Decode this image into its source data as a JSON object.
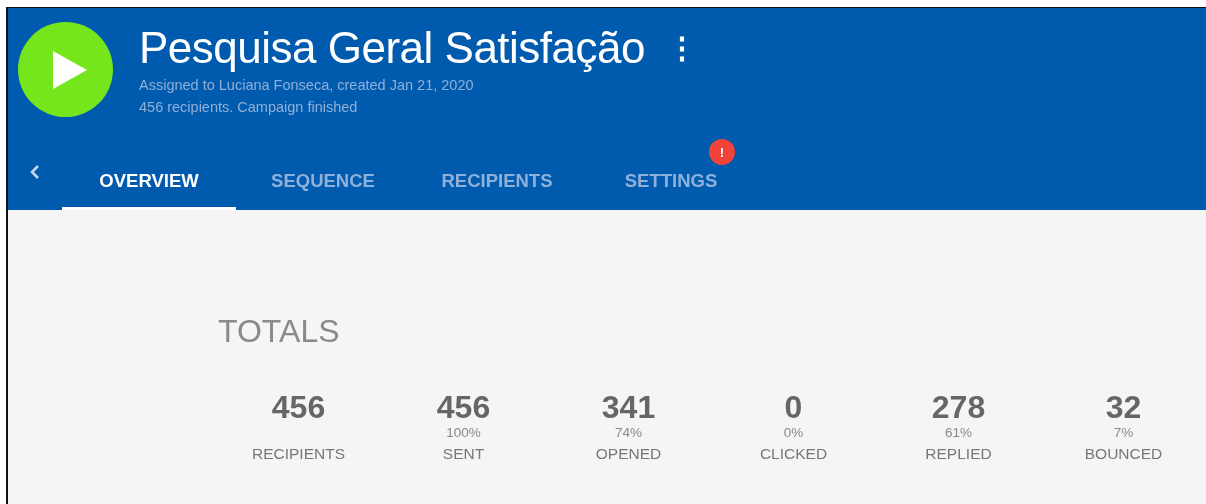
{
  "campaign": {
    "title": "Pesquisa Geral Satisfação",
    "assigned": "Assigned to Luciana Fonseca, created Jan 21, 2020",
    "status": "456 recipients. Campaign finished",
    "menu": "⋮"
  },
  "tabs": [
    {
      "label": "OVERVIEW",
      "selected": true
    },
    {
      "label": "SEQUENCE",
      "selected": false
    },
    {
      "label": "RECIPIENTS",
      "selected": false
    },
    {
      "label": "SETTINGS",
      "selected": false,
      "badge": "!"
    }
  ],
  "totals": {
    "heading": "TOTALS",
    "stats": [
      {
        "value": "456",
        "label": "RECIPIENTS"
      },
      {
        "value": "456",
        "percent": "100%",
        "label": "SENT"
      },
      {
        "value": "341",
        "percent": "74%",
        "label": "OPENED"
      },
      {
        "value": "0",
        "percent": "0%",
        "label": "CLICKED"
      },
      {
        "value": "278",
        "percent": "61%",
        "label": "REPLIED"
      },
      {
        "value": "32",
        "percent": "7%",
        "label": "BOUNCED"
      }
    ]
  }
}
